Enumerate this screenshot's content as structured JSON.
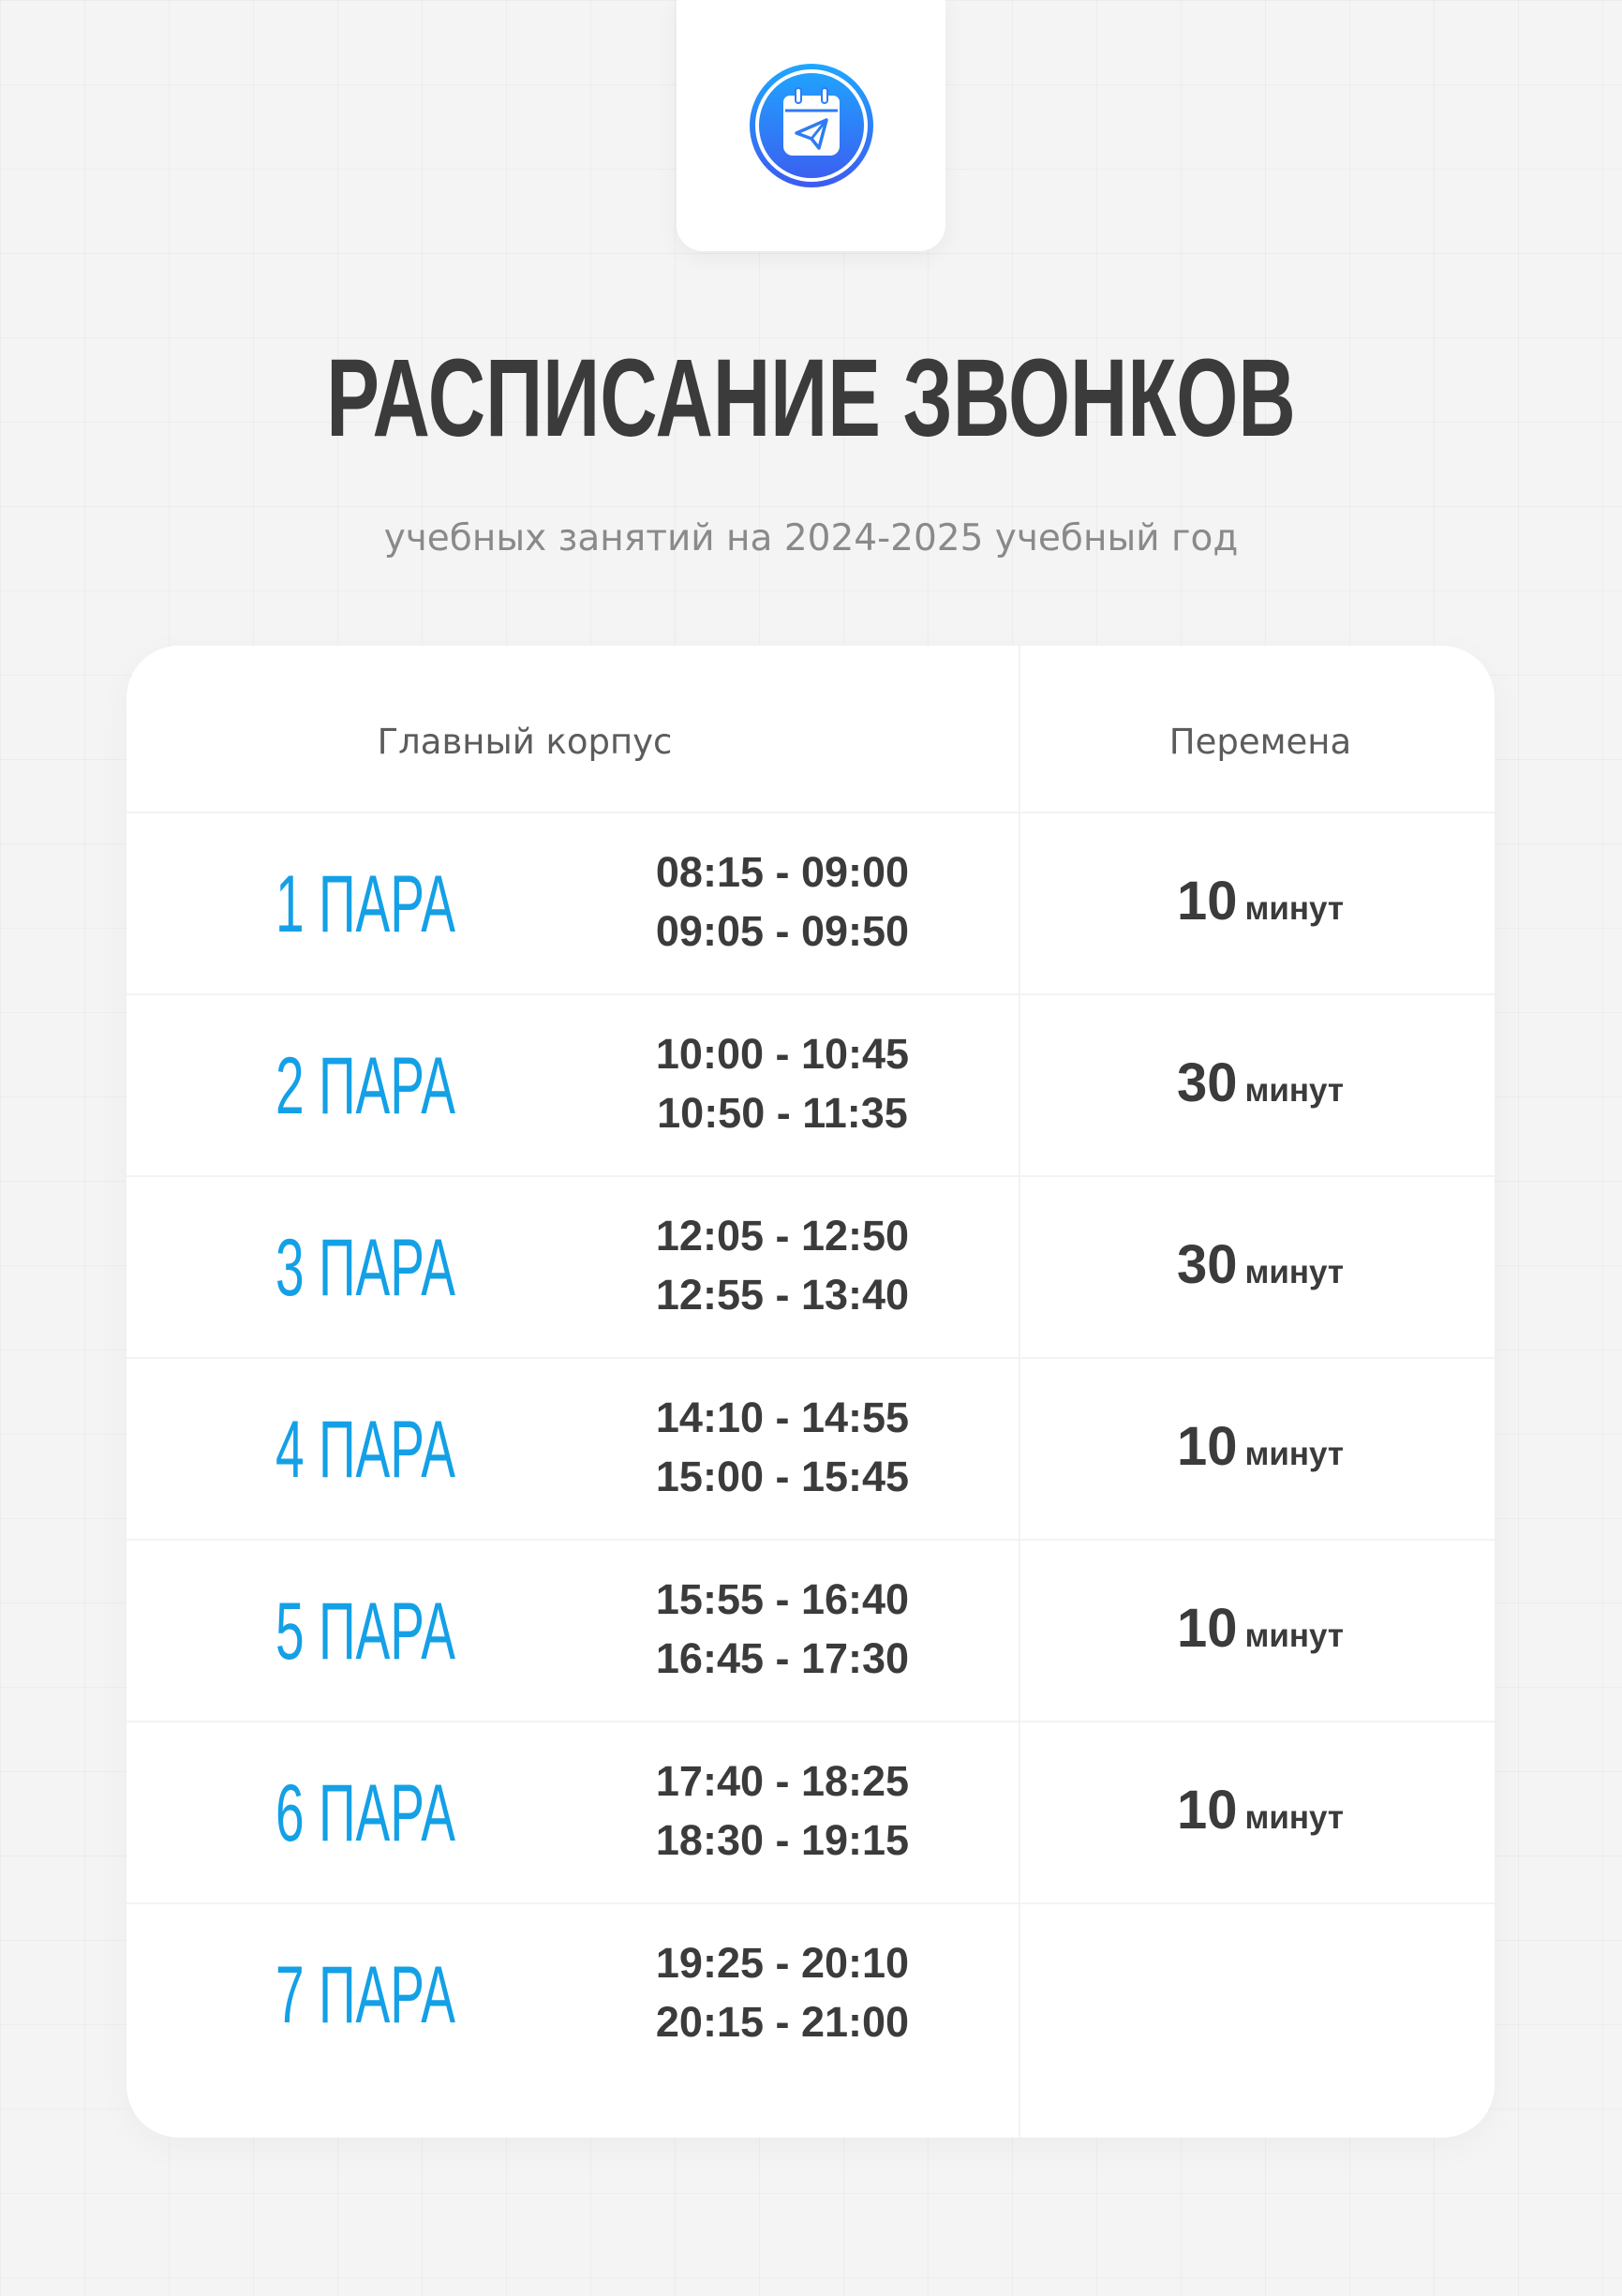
{
  "logo": {
    "icon": "calendar-paper-plane-icon",
    "gradient": [
      "#1ea7ff",
      "#3d5bf0"
    ]
  },
  "title": "РАСПИСАНИЕ ЗВОНКОВ",
  "subtitle": "учебных занятий на 2024-2025 учебный год",
  "table": {
    "header_main": "Главный корпус",
    "header_break": "Перемена",
    "rows": [
      {
        "label": "1 ПАРА",
        "time1": "08:15 - 09:00",
        "time2": "09:05 - 09:50",
        "break_num": "10",
        "break_unit": "минут"
      },
      {
        "label": "2 ПАРА",
        "time1": "10:00 - 10:45",
        "time2": "10:50 - 11:35",
        "break_num": "30",
        "break_unit": "минут"
      },
      {
        "label": "3 ПАРА",
        "time1": "12:05 - 12:50",
        "time2": "12:55 - 13:40",
        "break_num": "30",
        "break_unit": "минут"
      },
      {
        "label": "4 ПАРА",
        "time1": "14:10 - 14:55",
        "time2": "15:00 - 15:45",
        "break_num": "10",
        "break_unit": "минут"
      },
      {
        "label": "5 ПАРА",
        "time1": "15:55 - 16:40",
        "time2": "16:45 - 17:30",
        "break_num": "10",
        "break_unit": "минут"
      },
      {
        "label": "6 ПАРА",
        "time1": "17:40 - 18:25",
        "time2": "18:30 - 19:15",
        "break_num": "10",
        "break_unit": "минут"
      },
      {
        "label": "7 ПАРА",
        "time1": "19:25 - 20:10",
        "time2": "20:15 - 21:00"
      }
    ]
  },
  "colors": {
    "accent": "#14a0e6",
    "text": "#3b3b3b",
    "muted": "#8a8a8a",
    "background": "#f4f4f4"
  }
}
